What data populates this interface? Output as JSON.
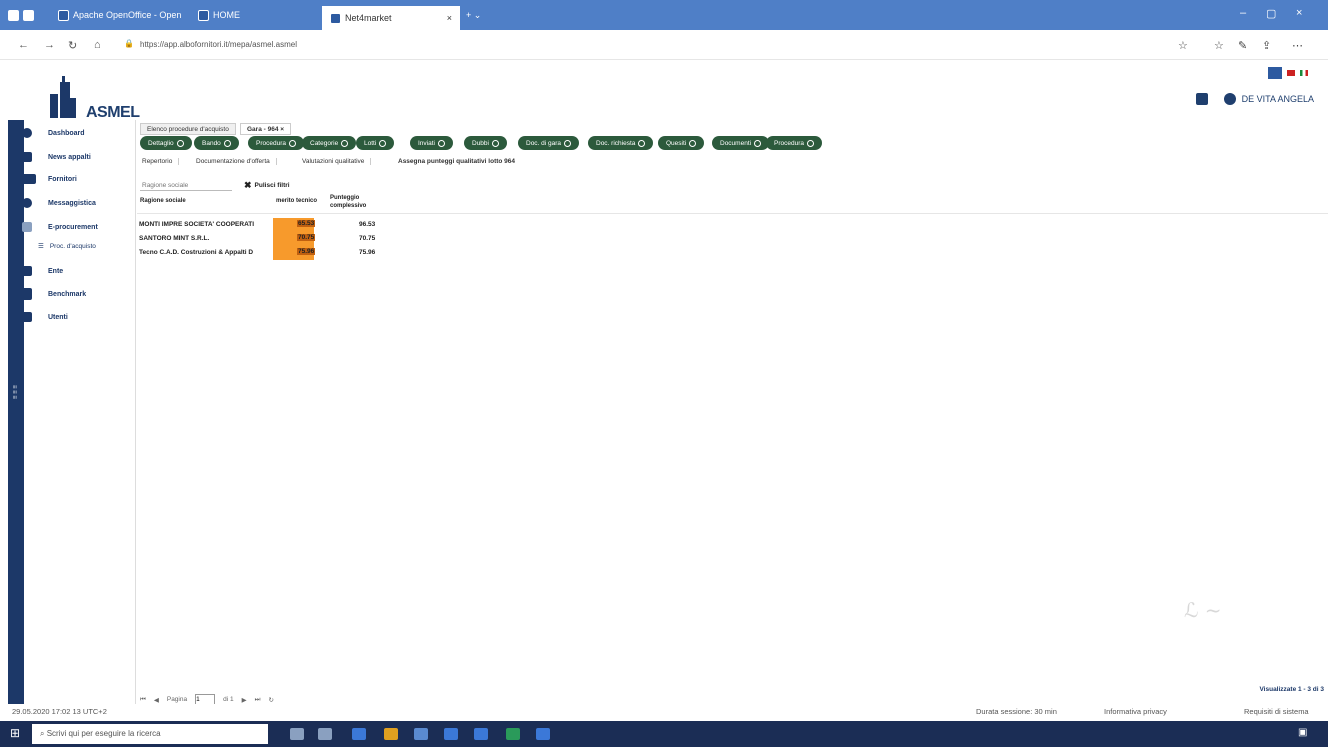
{
  "browser": {
    "tabs": [
      {
        "label": "Apache OpenOffice - Open"
      },
      {
        "label": "HOME"
      },
      {
        "label": "Net4market"
      }
    ],
    "url": "https://app.albofornitori.it/mepa/asmel.asmel"
  },
  "header": {
    "logo_text": "ASMEL",
    "user_name": "DE VITA ANGELA"
  },
  "sidebar": {
    "items": [
      {
        "label": "Dashboard",
        "icon": "speedometer-icon"
      },
      {
        "label": "News appalti",
        "icon": "news-icon"
      },
      {
        "label": "Fornitori",
        "icon": "truck-icon"
      },
      {
        "label": "Messaggistica",
        "icon": "message-icon"
      },
      {
        "label": "E-procurement",
        "icon": "cart-icon"
      },
      {
        "label": "Proc. d'acquisto",
        "icon": "list-icon"
      },
      {
        "label": "Ente",
        "icon": "building-icon"
      },
      {
        "label": "Benchmark",
        "icon": "chart-icon"
      },
      {
        "label": "Utenti",
        "icon": "user-icon"
      }
    ]
  },
  "top_tabs": [
    {
      "label": "Elenco procedure d'acquisto"
    },
    {
      "label": "Gara - 964"
    }
  ],
  "pills": [
    {
      "label": "Dettaglio"
    },
    {
      "label": "Bando"
    },
    {
      "label": "Procedura"
    },
    {
      "label": "Categorie"
    },
    {
      "label": "Lotti"
    },
    {
      "label": "Inviati"
    },
    {
      "label": "Dubbi"
    },
    {
      "label": "Doc. di gara"
    },
    {
      "label": "Doc. richiesta"
    },
    {
      "label": "Quesiti"
    },
    {
      "label": "Documenti"
    },
    {
      "label": "Procedura"
    }
  ],
  "sub_tabs": [
    {
      "label": "Repertorio"
    },
    {
      "label": "Documentazione d'offerta"
    },
    {
      "label": "Valutazioni qualitative"
    },
    {
      "label": "Assegna punteggi qualitativi lotto 964"
    }
  ],
  "filter": {
    "placeholder": "Ragione sociale",
    "clear_label": "Pulisci filtri"
  },
  "table": {
    "headers": {
      "name": "Ragione sociale",
      "merito": "merito tecnico",
      "total": "Punteggio complessivo"
    },
    "rows": [
      {
        "name": "MONTI IMPRE SOCIETA' COOPERATI",
        "merito": "65.53",
        "total": "96.53"
      },
      {
        "name": "SANTORO MINT S.R.L.",
        "merito": "70.75",
        "total": "70.75"
      },
      {
        "name": "Tecno C.A.D. Costruzioni & Appalti D",
        "merito": "75.96",
        "total": "75.96"
      }
    ]
  },
  "pager": {
    "label": "Pagina",
    "page": "1",
    "of": "di 1"
  },
  "view_count": "Visualizzate 1 - 3 di 3",
  "footer": {
    "left": "29.05.2020 17:02 13 UTC+2",
    "session": "Durata sessione: 30 min",
    "privacy": "Informativa privacy",
    "requirements": "Requisiti di sistema"
  },
  "taskbar": {
    "search_placeholder": "Scrivi qui per eseguire la ricerca"
  },
  "colors": {
    "brand": "#1c3868",
    "pill": "#2c5a3c",
    "highlight": "#f79a2c",
    "browser": "#4f7fc7"
  }
}
